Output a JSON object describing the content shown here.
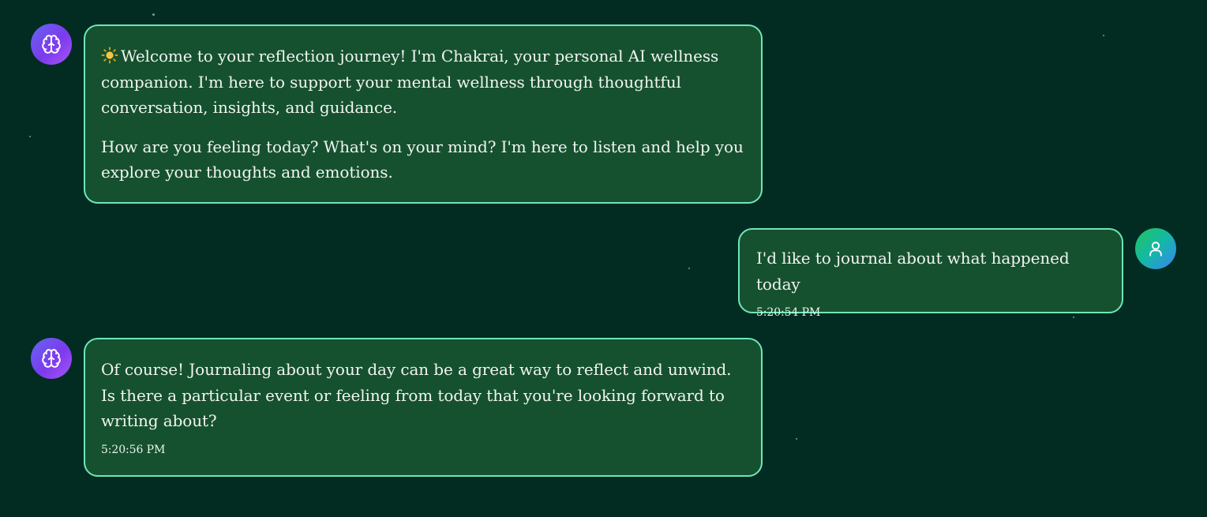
{
  "theme": {
    "background": "#022c22",
    "bubble_background": "#16512f",
    "bubble_border": "#6ee7b7",
    "text_color": "#f1f5f1",
    "ai_avatar_gradient": [
      "#6366f1",
      "#a855f7"
    ],
    "user_avatar_gradient": [
      "#22c55e",
      "#3b82f6"
    ]
  },
  "messages": [
    {
      "role": "assistant",
      "avatar_icon": "brain-icon",
      "paragraphs": [
        "Welcome to your reflection journey! I'm Chakrai, your personal AI wellness companion. I'm here to support your mental wellness through thoughtful conversation, insights, and guidance.",
        "How are you feeling today? What's on your mind? I'm here to listen and help you explore your thoughts and emotions."
      ],
      "emoji_icon": "sun-icon",
      "time": ""
    },
    {
      "role": "user",
      "avatar_icon": "user-icon",
      "paragraphs": [
        "I'd like to journal about what happened today"
      ],
      "time": "5:20:54 PM"
    },
    {
      "role": "assistant",
      "avatar_icon": "brain-icon",
      "paragraphs": [
        "Of course! Journaling about your day can be a great way to reflect and unwind. Is there a particular event or feeling from today that you're looking forward to writing about?"
      ],
      "time": "5:20:56 PM"
    }
  ]
}
